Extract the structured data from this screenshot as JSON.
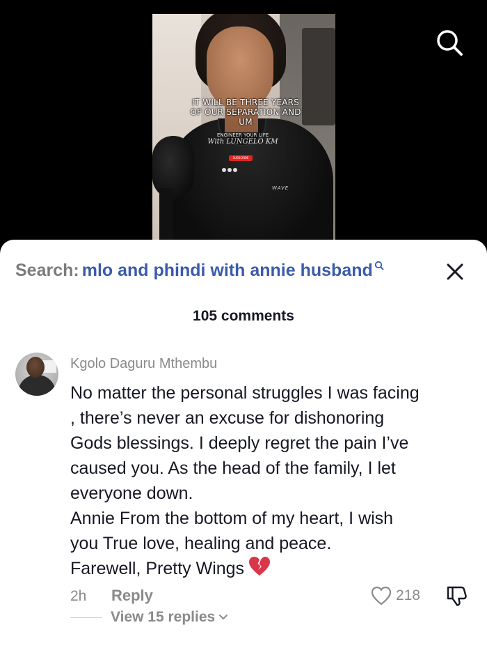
{
  "video": {
    "caption_lines": [
      "IT WILL BE THREE YEARS",
      "OF OUR SEPARATION AND",
      "UM"
    ],
    "brand_line1": "ENGINEER YOUR LIFE",
    "brand_line2": "With LUNGELO KM",
    "subscribe_label": "SUBSCRIBE",
    "logo_text": "WAVE"
  },
  "header": {
    "search_icon": "search-icon"
  },
  "sheet": {
    "search_prefix": "Search:",
    "search_query": "mlo and phindi with annie husband",
    "close_icon": "close-icon",
    "comment_count": "105 comments"
  },
  "comment": {
    "author": "Kgolo Daguru Mthembu",
    "text": "No matter the personal struggles I was facing\n, there’s never an excuse for dishonoring\nGods blessings. I deeply regret the pain I’ve\ncaused you. As the head of the family, I let\neveryone down.\nAnnie From the bottom of my heart, I wish\nyou True love, healing and peace.\nFarewell, Pretty Wings",
    "emoji": "broken-heart",
    "time": "2h",
    "reply_label": "Reply",
    "like_count": "218",
    "view_replies_label": "View 15 replies"
  },
  "colors": {
    "query_blue": "#3b5bab",
    "muted_gray": "#8a8a8a",
    "text_dark": "#161823",
    "broken_heart_red": "#d9364a"
  }
}
